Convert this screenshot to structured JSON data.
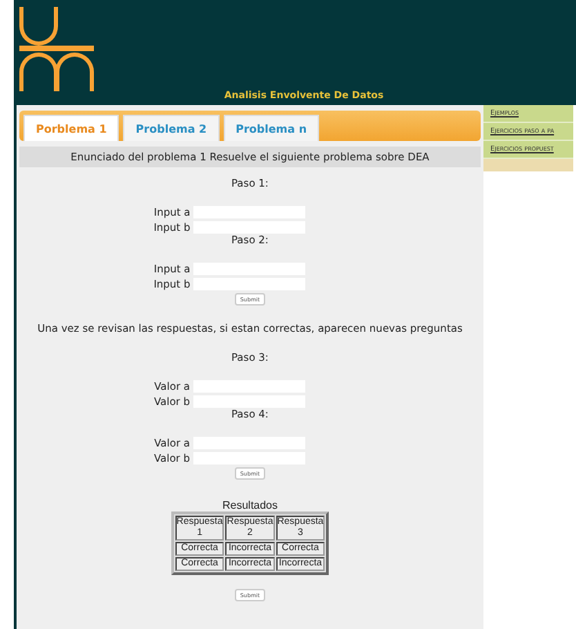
{
  "header": {
    "title": "Analisis Envolvente De Datos"
  },
  "tabs": [
    {
      "label": "Porblema 1",
      "selected": true
    },
    {
      "label": "Problema 2",
      "selected": false
    },
    {
      "label": "Problema n",
      "selected": false
    }
  ],
  "statement": "Enunciado del problema 1 Resuelve el siguiente problema sobre DEA",
  "blocks": [
    {
      "kind": "step",
      "title": "Paso 1:",
      "fields": [
        {
          "label": "Input a"
        },
        {
          "label": "Input b"
        }
      ]
    },
    {
      "kind": "step",
      "title": "Paso 2:",
      "fields": [
        {
          "label": "Input a"
        },
        {
          "label": "Input b"
        }
      ]
    },
    {
      "kind": "button",
      "label": "Submit"
    },
    {
      "kind": "note",
      "text": "Una vez se revisan las respuestas, si estan correctas, aparecen nuevas preguntas"
    },
    {
      "kind": "step",
      "title": "Paso 3:",
      "fields": [
        {
          "label": "Valor a"
        },
        {
          "label": "Valor b"
        }
      ]
    },
    {
      "kind": "step",
      "title": "Paso 4:",
      "fields": [
        {
          "label": "Valor a"
        },
        {
          "label": "Valor b"
        }
      ]
    },
    {
      "kind": "button",
      "label": "Submit"
    },
    {
      "kind": "results",
      "title": "Resultados",
      "columns": [
        "Respuesta 1",
        "Respuesta 2",
        "Respuesta 3"
      ],
      "rows": [
        [
          "Correcta",
          "Incorrecta",
          "Correcta"
        ],
        [
          "Correcta",
          "Incorrecta",
          "Incorrecta"
        ]
      ]
    },
    {
      "kind": "button",
      "label": "Submit"
    }
  ],
  "sidebar": {
    "items": [
      "Ejemplos",
      "Ejercicios paso a pa",
      "Ejercicios propuest"
    ]
  }
}
